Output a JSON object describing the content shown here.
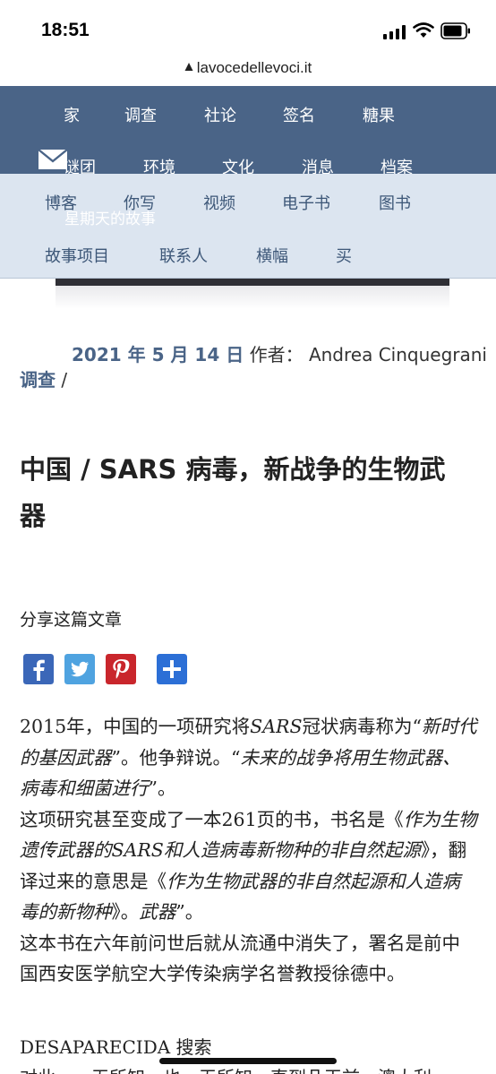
{
  "status_bar": {
    "time": "18:51"
  },
  "browser": {
    "url": "lavocedellevoci.it"
  },
  "nav": {
    "primary_row1": [
      "家",
      "调查",
      "社论",
      "签名",
      "糖果"
    ],
    "primary_row2": [
      "谜团",
      "环境",
      "文化",
      "消息",
      "档案"
    ],
    "secondary_row1": [
      "博客",
      "你写",
      "视频",
      "电子书",
      "图书"
    ],
    "secondary_row2": [
      "故事项目",
      "联系人",
      "横幅",
      "买"
    ],
    "overlay": "星期天的故事"
  },
  "article": {
    "date": "2021 年 5 月 14 日",
    "author_label": "作者：",
    "author": "Andrea Cinquegrani",
    "category": "调查",
    "category_sep": " /",
    "title_prefix": "中国 / ",
    "title_bold": "SARS",
    "title_suffix": " 病毒，新战争的生物武器",
    "share_label": "分享这篇文章",
    "share_buttons": [
      "facebook-icon",
      "twitter-icon",
      "pinterest-icon",
      "share-plus-icon"
    ],
    "p1_a": "2015年，中国的一项研究将",
    "p1_b": "SARS",
    "p1_c": "冠状病毒称为“",
    "p1_d": "新时代的基因武器",
    "p1_e": "”。他争辩说。“",
    "p1_f": "未来的战争将用生物武器、病毒和细菌进行",
    "p1_g": "”。",
    "p2_a": "这项研究甚至变成了一本261页的书，书名是《",
    "p2_b": "作为生物遗传武器的SARS和人造病毒新物种的非自然起源",
    "p2_c": "》，翻译过来的意思是《",
    "p2_d": "作为生物武器的非自然起源和人造病毒的新物种",
    "p2_e": "》。",
    "p2_f": "武器",
    "p2_g": "”。",
    "p3": "这本书在六年前问世后就从流通中消失了，署名是前中国西安医学航空大学传染病学名誉教授徐德中。",
    "section_heading": "DESAPARECIDA 搜索",
    "next_line": "对此，一无所知，也一无所知，直到几天前，澳大利"
  },
  "colors": {
    "nav_primary": "#4a6487",
    "nav_secondary": "#dce5f0",
    "accent": "#4a6487"
  }
}
